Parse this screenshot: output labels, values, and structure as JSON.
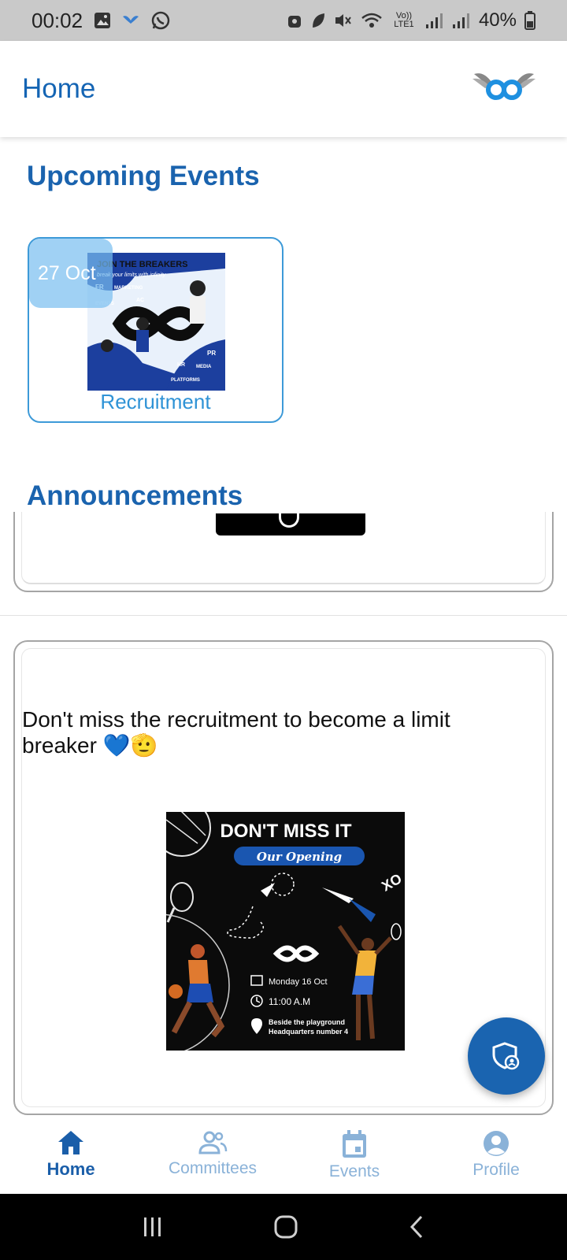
{
  "status_bar": {
    "time": "00:02",
    "network": "Vo)) LTE1",
    "battery": "40%",
    "background": "#c9c9c9"
  },
  "app_bar": {
    "title": "Home",
    "logo_icon": "infinity-wings-logo"
  },
  "upcoming_events": {
    "heading": "Upcoming Events",
    "events": [
      {
        "date": "27 Oct",
        "name": "Recruitment",
        "poster": {
          "headline": "JOIN THE BREAKERS",
          "tagline": "break your limits with infinity",
          "labels": [
            "FR",
            "MARKETING",
            "EVENTS",
            "AC",
            "PR",
            "HR",
            "MEDIA",
            "PLATFORMS"
          ]
        }
      }
    ]
  },
  "announcements": {
    "heading": "Announcements",
    "posts": [
      {
        "text": "Don't miss the recruitment to become a limit breaker 💙🫡",
        "flyer": {
          "headline": "DON'T MISS IT",
          "subheadline": "Our Opening",
          "date": "Monday 16 Oct",
          "time": "11:00 A.M",
          "location_line1": "Beside the playground",
          "location_line2": "Headquarters number 4",
          "side_text": "XO"
        }
      }
    ]
  },
  "fab": {
    "icon": "shield-user-icon"
  },
  "bottom_nav": {
    "items": [
      {
        "label": "Home",
        "icon": "home-icon",
        "active": true
      },
      {
        "label": "Committees",
        "icon": "people-icon",
        "active": false
      },
      {
        "label": "Events",
        "icon": "calendar-icon",
        "active": false
      },
      {
        "label": "Profile",
        "icon": "profile-icon",
        "active": false
      }
    ]
  },
  "colors": {
    "primary": "#1a64b0",
    "accent": "#2f93d6",
    "inactive_nav": "#8ab2d8"
  }
}
